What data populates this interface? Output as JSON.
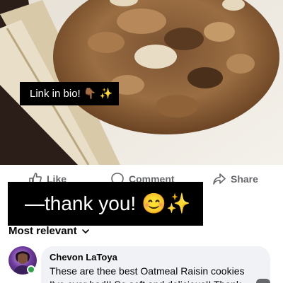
{
  "post": {
    "image_caption": "Link in bio! 👇🏾 ✨"
  },
  "actions": {
    "like_label": "Like",
    "comment_label": "Comment",
    "share_label": "Share"
  },
  "banner": {
    "text": "—thank you! 😊✨"
  },
  "comments": {
    "sort_label": "Most relevant",
    "items": [
      {
        "author": "Chevon LaToya",
        "text": "These are thee best Oatmeal Raisin cookies I've ever had!! So soft and delicious!! Thank",
        "online": true
      }
    ]
  },
  "colors": {
    "action_text": "#65676b",
    "bubble_bg": "#f0f2f5",
    "online_dot": "#31a24c"
  }
}
